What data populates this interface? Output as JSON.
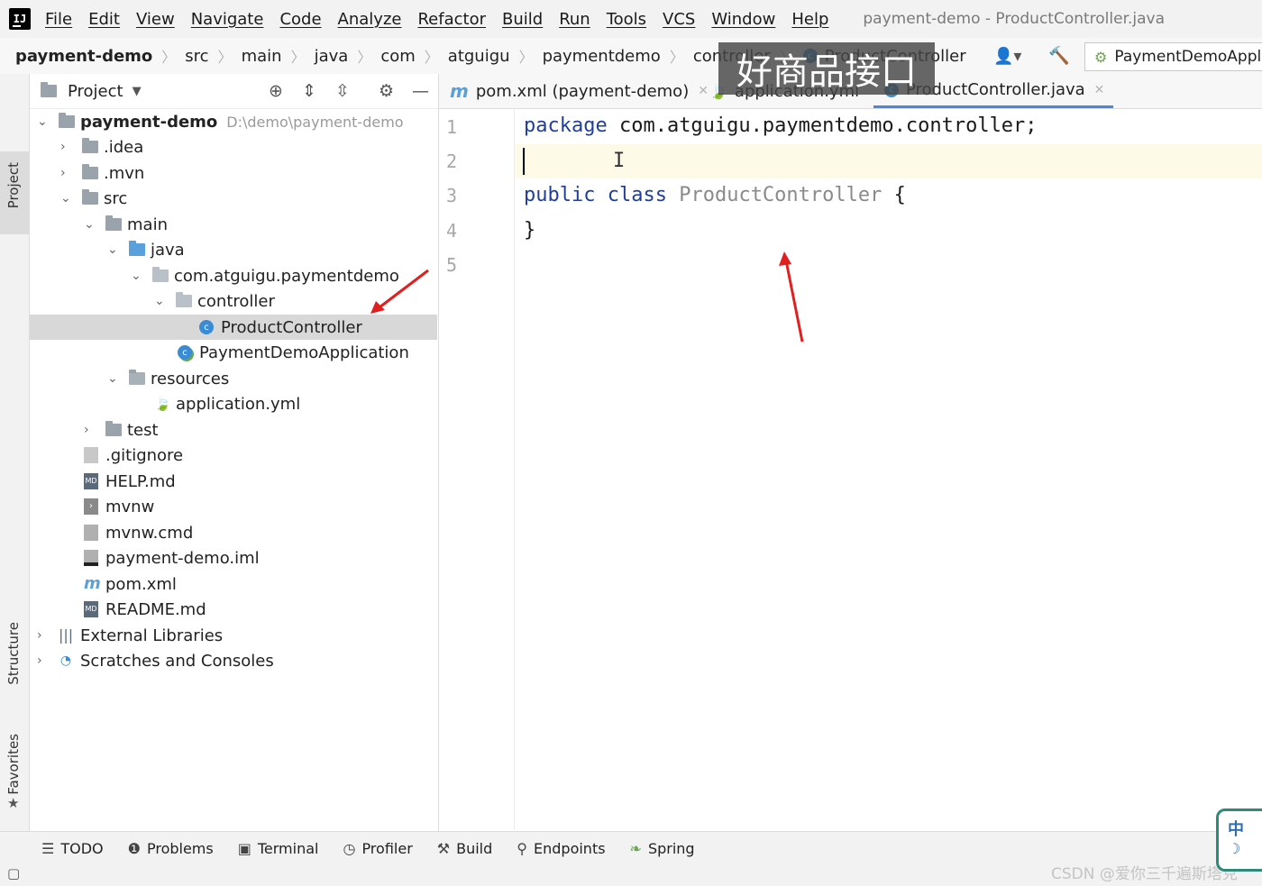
{
  "menubar": {
    "logo": "IJ",
    "items": [
      "File",
      "Edit",
      "View",
      "Navigate",
      "Code",
      "Analyze",
      "Refactor",
      "Build",
      "Run",
      "Tools",
      "VCS",
      "Window",
      "Help"
    ],
    "window_title": "payment-demo - ProductController.java"
  },
  "breadcrumb": {
    "items": [
      "payment-demo",
      "src",
      "main",
      "java",
      "com",
      "atguigu",
      "paymentdemo",
      "controller",
      "ProductController"
    ]
  },
  "run_config": {
    "label": "PaymentDemoApplic"
  },
  "left_stripe": {
    "project": "Project",
    "structure": "Structure",
    "favorites": "Favorites"
  },
  "project_panel": {
    "title": "Project",
    "tree": [
      {
        "label": "payment-demo",
        "hint": "D:\\demo\\payment-demo",
        "depth": 0,
        "expand": "open",
        "icon": "folder"
      },
      {
        "label": ".idea",
        "depth": 1,
        "expand": "closed",
        "icon": "folder"
      },
      {
        "label": ".mvn",
        "depth": 1,
        "expand": "closed",
        "icon": "folder"
      },
      {
        "label": "src",
        "depth": 1,
        "expand": "open",
        "icon": "folder"
      },
      {
        "label": "main",
        "depth": 2,
        "expand": "open",
        "icon": "folder"
      },
      {
        "label": "java",
        "depth": 3,
        "expand": "open",
        "icon": "folder-blue"
      },
      {
        "label": "com.atguigu.paymentdemo",
        "depth": 4,
        "expand": "open",
        "icon": "folder-pkg"
      },
      {
        "label": "controller",
        "depth": 5,
        "expand": "open",
        "icon": "folder-pkg"
      },
      {
        "label": "ProductController",
        "depth": 6,
        "expand": "none",
        "icon": "class",
        "selected": true
      },
      {
        "label": "PaymentDemoApplication",
        "depth": 5,
        "expand": "none",
        "icon": "spring-class"
      },
      {
        "label": "resources",
        "depth": 3,
        "expand": "open",
        "icon": "folder-res"
      },
      {
        "label": "application.yml",
        "depth": 4,
        "expand": "none",
        "icon": "yml"
      },
      {
        "label": "test",
        "depth": 2,
        "expand": "closed",
        "icon": "folder"
      },
      {
        "label": ".gitignore",
        "depth": 1,
        "expand": "none",
        "icon": "gitignore"
      },
      {
        "label": "HELP.md",
        "depth": 1,
        "expand": "none",
        "icon": "md"
      },
      {
        "label": "mvnw",
        "depth": 1,
        "expand": "none",
        "icon": "script"
      },
      {
        "label": "mvnw.cmd",
        "depth": 1,
        "expand": "none",
        "icon": "text"
      },
      {
        "label": "payment-demo.iml",
        "depth": 1,
        "expand": "none",
        "icon": "iml"
      },
      {
        "label": "pom.xml",
        "depth": 1,
        "expand": "none",
        "icon": "maven"
      },
      {
        "label": "README.md",
        "depth": 1,
        "expand": "none",
        "icon": "md"
      },
      {
        "label": "External Libraries",
        "depth": 0,
        "expand": "closed",
        "icon": "libraries"
      },
      {
        "label": "Scratches and Consoles",
        "depth": 0,
        "expand": "closed",
        "icon": "scratches"
      }
    ]
  },
  "editor": {
    "tabs": [
      {
        "label": "pom.xml (payment-demo)",
        "icon": "maven",
        "active": false
      },
      {
        "label": "application.yml",
        "icon": "yml",
        "active": false
      },
      {
        "label": "ProductController.java",
        "icon": "class",
        "active": true
      }
    ],
    "line_numbers": [
      "1",
      "2",
      "3",
      "4",
      "5"
    ],
    "code": {
      "line1_kw": "package",
      "line1_rest": " com.atguigu.paymentdemo.controller;",
      "line3_kw1": "public",
      "line3_kw2": "class",
      "line3_cls": "ProductController",
      "line3_brace": " {",
      "line4": "}"
    }
  },
  "overlay_banner": "好商品接口",
  "bottom_toolbar": [
    {
      "label": "TODO",
      "icon": "list-icon"
    },
    {
      "label": "Problems",
      "icon": "problems-icon"
    },
    {
      "label": "Terminal",
      "icon": "terminal-icon"
    },
    {
      "label": "Profiler",
      "icon": "profiler-icon"
    },
    {
      "label": "Build",
      "icon": "hammer-icon"
    },
    {
      "label": "Endpoints",
      "icon": "endpoints-icon"
    },
    {
      "label": "Spring",
      "icon": "spring-icon"
    }
  ],
  "ime": {
    "char": "中"
  },
  "watermark": "CSDN @爱你三千遍斯塔克",
  "colors": {
    "accent": "#4a87d8",
    "keyword": "#1f3f9a",
    "annotation_arrow": "#e02020",
    "selection": "#d8d8d8"
  }
}
